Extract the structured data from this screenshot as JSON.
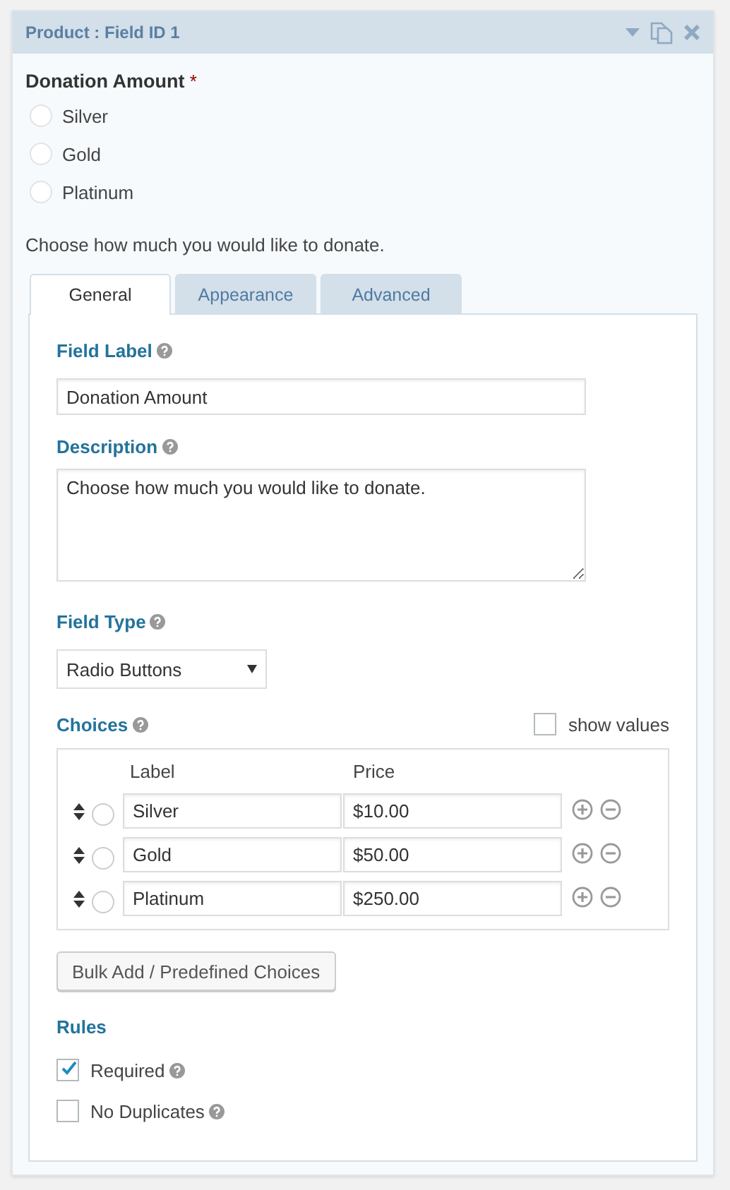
{
  "panel": {
    "title": "Product : Field ID 1"
  },
  "preview": {
    "label": "Donation Amount",
    "required_mark": "*",
    "options": [
      {
        "label": "Silver",
        "selected": false
      },
      {
        "label": "Gold",
        "selected": false
      },
      {
        "label": "Platinum",
        "selected": false
      }
    ],
    "description": "Choose how much you would like to donate."
  },
  "tabs": [
    {
      "label": "General",
      "selected": true
    },
    {
      "label": "Appearance",
      "selected": false
    },
    {
      "label": "Advanced",
      "selected": false
    }
  ],
  "settings": {
    "field_label": {
      "label": "Field Label",
      "value": "Donation Amount"
    },
    "description": {
      "label": "Description",
      "value": "Choose how much you would like to donate."
    },
    "field_type": {
      "label": "Field Type",
      "value": "Radio Buttons"
    },
    "choices": {
      "label": "Choices",
      "show_values": {
        "label": "show values",
        "checked": false
      },
      "columns": [
        "Label",
        "Price"
      ],
      "rows": [
        {
          "label": "Silver",
          "price": "$10.00",
          "selected": false
        },
        {
          "label": "Gold",
          "price": "$50.00",
          "selected": false
        },
        {
          "label": "Platinum",
          "price": "$250.00",
          "selected": false
        }
      ]
    },
    "bulk_button": "Bulk Add / Predefined Choices",
    "rules": {
      "title": "Rules",
      "items": [
        {
          "label": "Required",
          "checked": true,
          "help": true
        },
        {
          "label": "No Duplicates",
          "checked": false,
          "help": true
        }
      ]
    }
  }
}
